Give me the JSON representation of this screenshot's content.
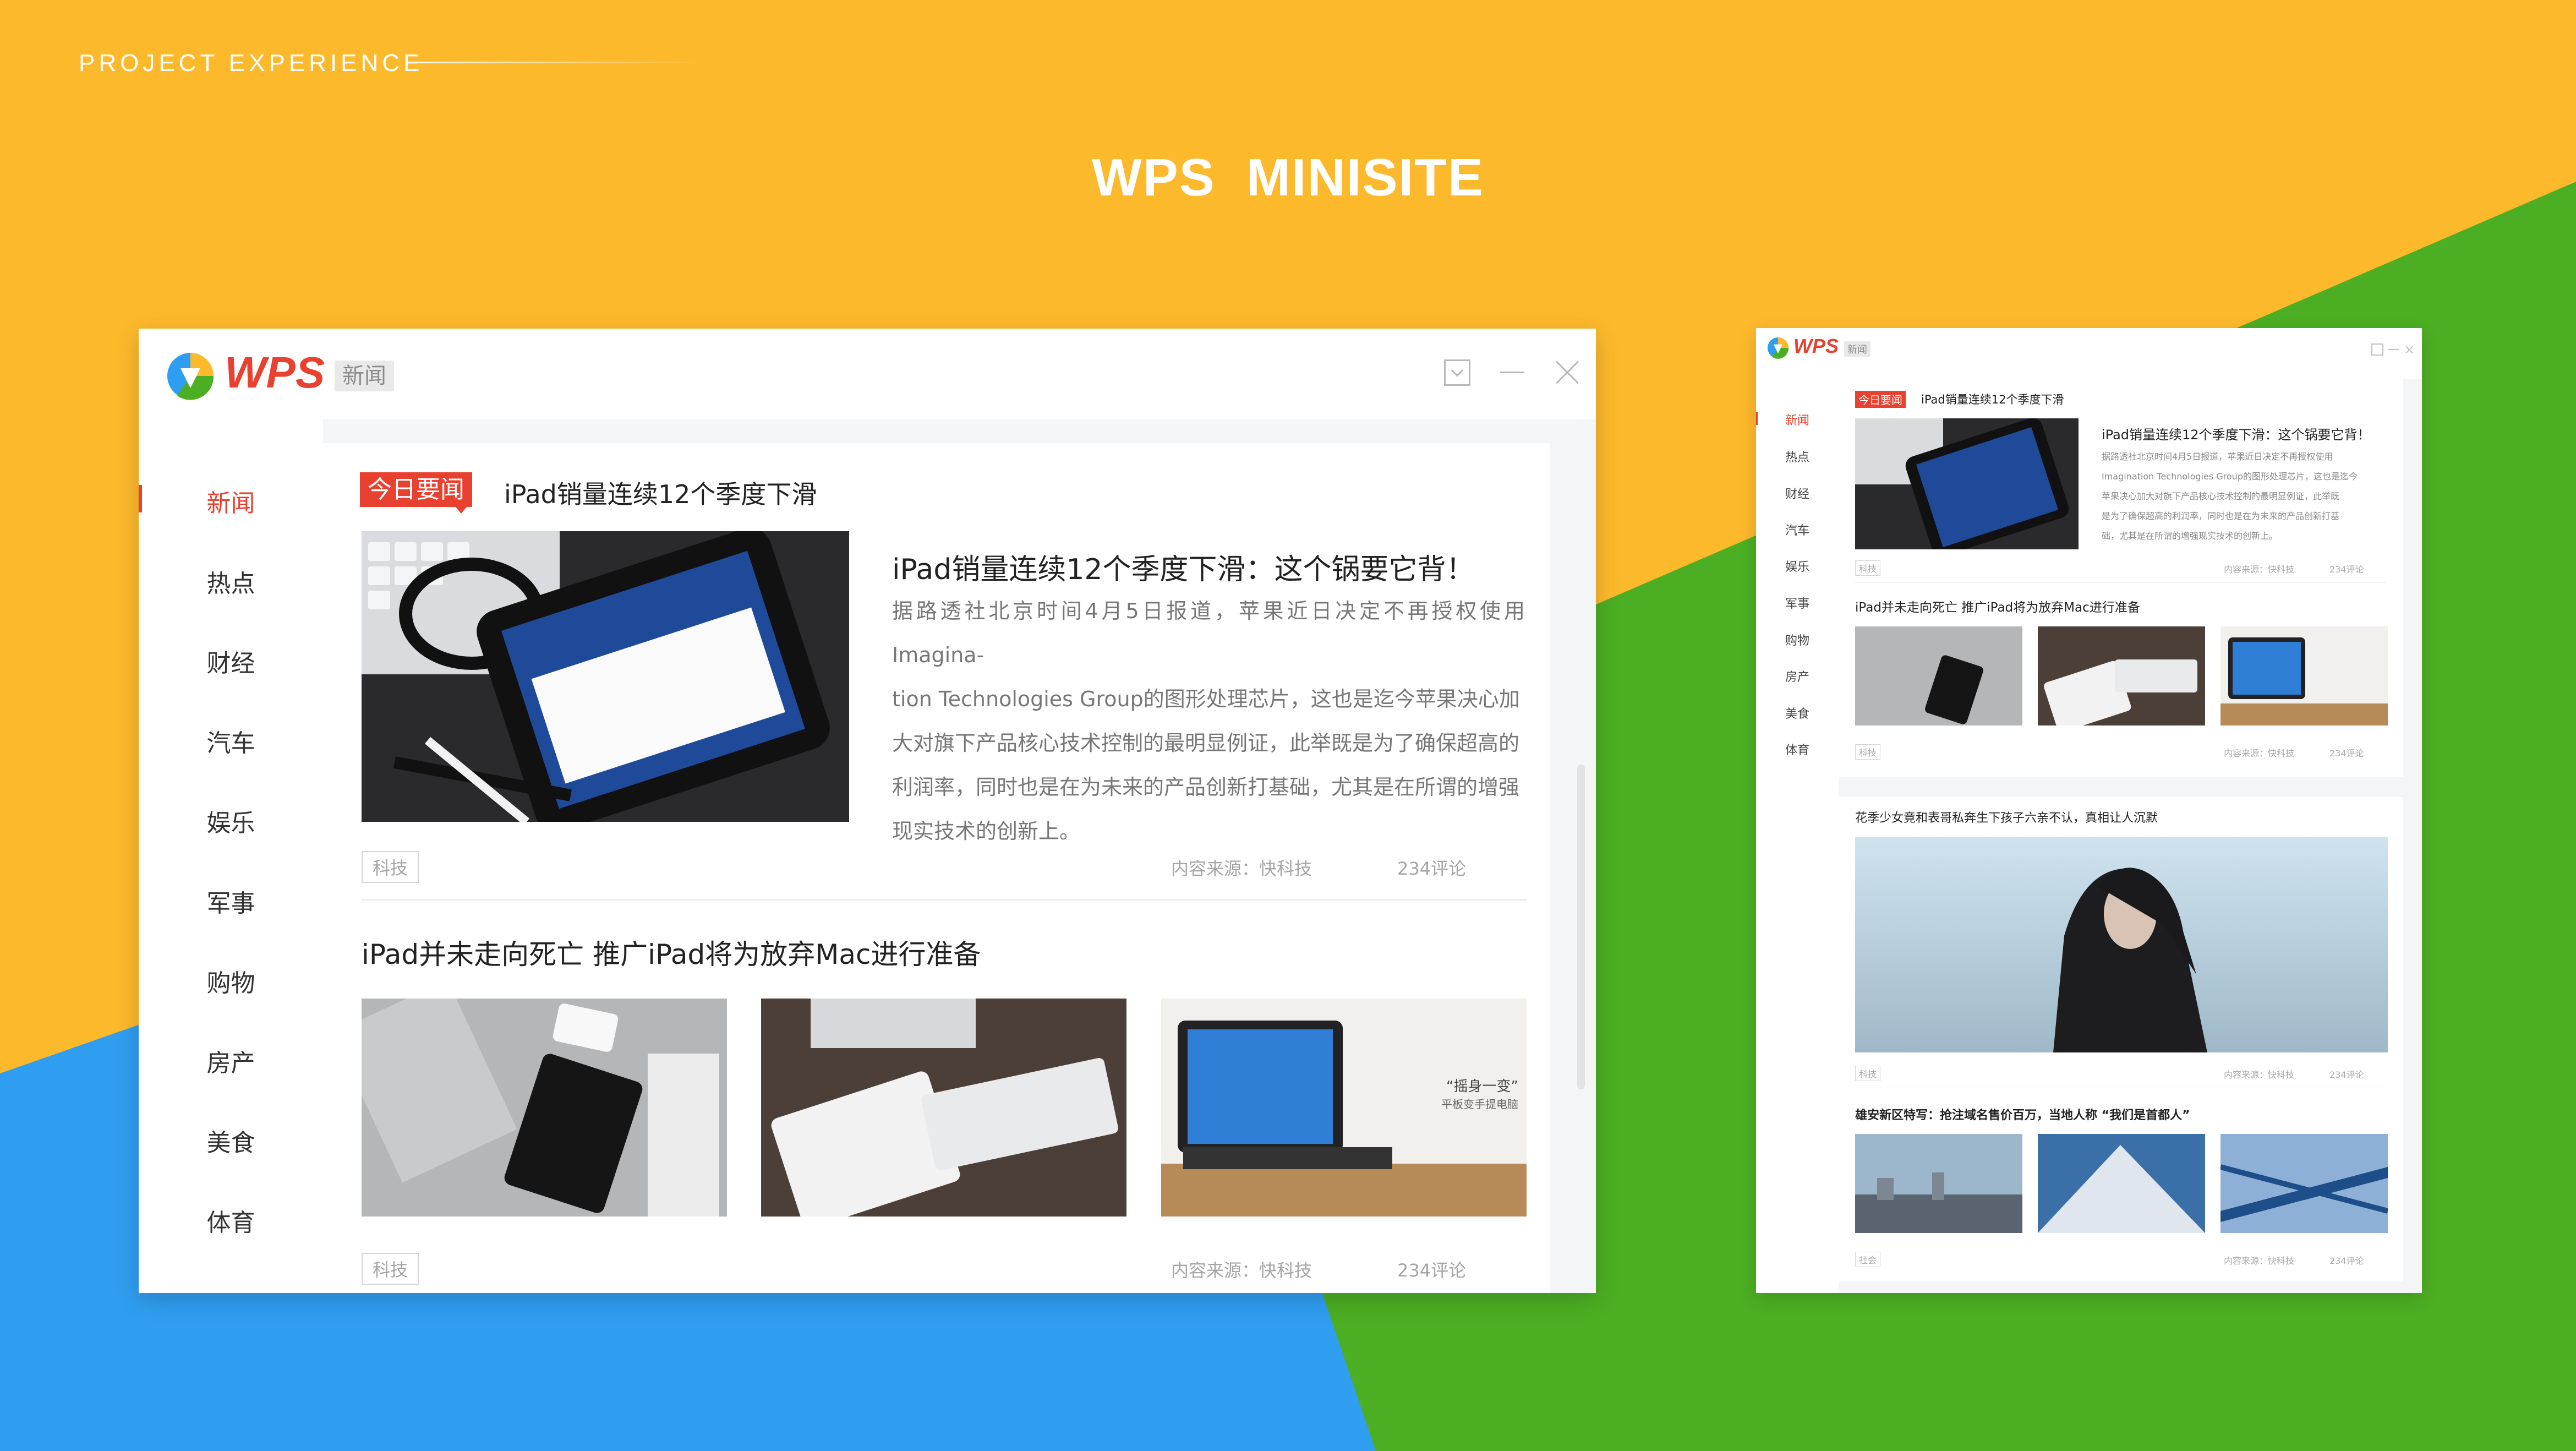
{
  "slide": {
    "section_label": "PROJECT EXPERIENCE",
    "title_a": "WPS",
    "title_b": "MINISITE"
  },
  "colors": {
    "orange": "#fdb92c",
    "green": "#4caf23",
    "blue": "#2f9ef0",
    "accent_red": "#e8412f"
  },
  "large_window": {
    "logo_text": "WPS",
    "logo_chip": "新闻",
    "nav": [
      "新闻",
      "热点",
      "财经",
      "汽车",
      "娱乐",
      "军事",
      "购物",
      "房产",
      "美食",
      "体育"
    ],
    "active_nav": "新闻",
    "card1": {
      "badge": "今日要闻",
      "lead": "iPad销量连续12个季度下滑",
      "title": "iPad销量连续12个季度下滑：这个锅要它背！",
      "body_lines": [
        "据路透社北京时间4月5日报道，苹果近日决定不再授权使用Imagina-",
        "tion Technologies Group的图形处理芯片，这也是迄今苹果决心加",
        "大对旗下产品核心技术控制的最明显例证，此举既是为了确保超高的",
        "利润率，同时也是在为未来的产品创新打基础，尤其是在所谓的增强",
        "现实技术的创新上。"
      ],
      "tag": "科技",
      "source": "内容来源：快科技",
      "comments": "234评论"
    },
    "card2": {
      "title": "iPad并未走向死亡 推广iPad将为放弃Mac进行准备",
      "photo3_caption_main": "“摇身一变”",
      "photo3_caption_sub": "平板变手提电脑",
      "tag": "科技",
      "source": "内容来源：快科技",
      "comments": "234评论"
    }
  },
  "small_window": {
    "logo_text": "WPS",
    "logo_chip": "新闻",
    "nav": [
      "新闻",
      "热点",
      "财经",
      "汽车",
      "娱乐",
      "军事",
      "购物",
      "房产",
      "美食",
      "体育"
    ],
    "card1": {
      "badge": "今日要闻",
      "lead": "iPad销量连续12个季度下滑",
      "title": "iPad销量连续12个季度下滑：这个锅要它背！",
      "body_lines": [
        "据路透社北京时间4月5日报道，苹果近日决定不再授权使用",
        "Imagination Technologies Group的图形处理芯片，这也是迄今",
        "苹果决心加大对旗下产品核心技术控制的最明显例证，此举既",
        "是为了确保超高的利润率，同时也是在为未来的产品创新打基",
        "础，尤其是在所谓的增强现实技术的创新上。"
      ],
      "tag": "科技",
      "source": "内容来源：快科技",
      "comments": "234评论"
    },
    "card2": {
      "title": "iPad并未走向死亡 推广iPad将为放弃Mac进行准备",
      "tag": "科技",
      "source": "内容来源：快科技",
      "comments": "234评论"
    },
    "card3": {
      "title": "花季少女竟和表哥私奔生下孩子六亲不认，真相让人沉默",
      "tag": "科技",
      "source": "内容来源：快科技",
      "comments": "234评论"
    },
    "card4": {
      "title": "雄安新区特写：抢注域名售价百万，当地人称 “我们是首都人”",
      "tag": "社会",
      "source": "内容来源：快科技",
      "comments": "234评论"
    }
  }
}
